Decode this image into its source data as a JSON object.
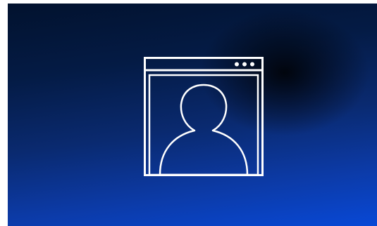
{
  "illustration": {
    "icon": "browser-window-user-profile-icon",
    "background_colors": {
      "top": "#02122e",
      "bottom": "#0848d6",
      "shadow": "#000000"
    },
    "stroke_color": "#ffffff"
  }
}
